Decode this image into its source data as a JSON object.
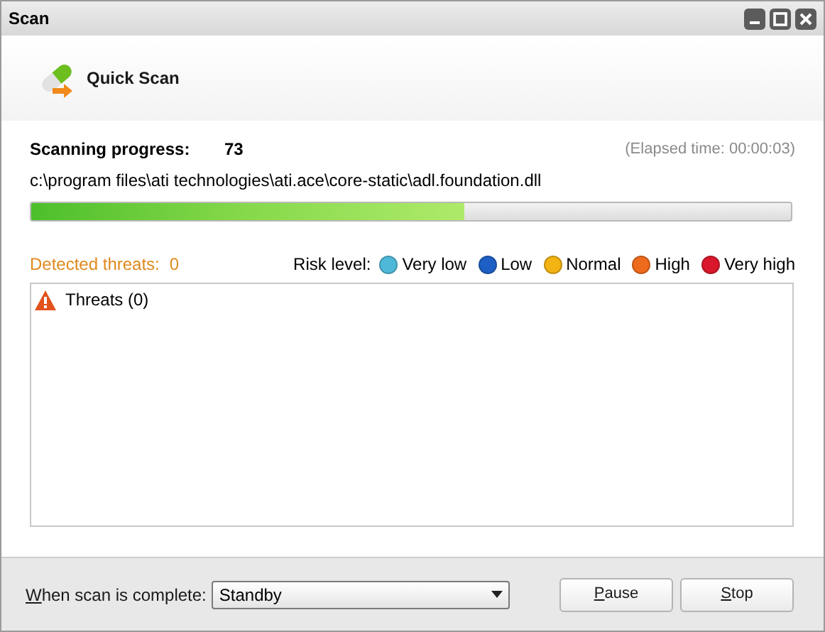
{
  "window": {
    "title": "Scan"
  },
  "header": {
    "title": "Quick Scan"
  },
  "progress": {
    "label": "Scanning progress:",
    "value": "73",
    "elapsed": "(Elapsed time: 00:00:03)",
    "current_file": "c:\\program files\\ati technologies\\ati.ace\\core-static\\adl.foundation.dll",
    "level": 0.57
  },
  "threats": {
    "label": "Detected threats:",
    "count": "0"
  },
  "risk_legend": {
    "label": "Risk level:",
    "levels": [
      {
        "name": "Very low",
        "color": "#4fb8d8"
      },
      {
        "name": "Low",
        "color": "#1d5fc4"
      },
      {
        "name": "Normal",
        "color": "#f2b313"
      },
      {
        "name": "High",
        "color": "#ee6a1c"
      },
      {
        "name": "Very high",
        "color": "#d9182b"
      }
    ]
  },
  "threat_tree": [
    {
      "label": "Threats (0)"
    }
  ],
  "footer": {
    "label": "When scan is complete:",
    "option": {
      "value": "Standby"
    },
    "buttons": [
      {
        "label": "Pause"
      },
      {
        "label": "Stop"
      }
    ]
  }
}
